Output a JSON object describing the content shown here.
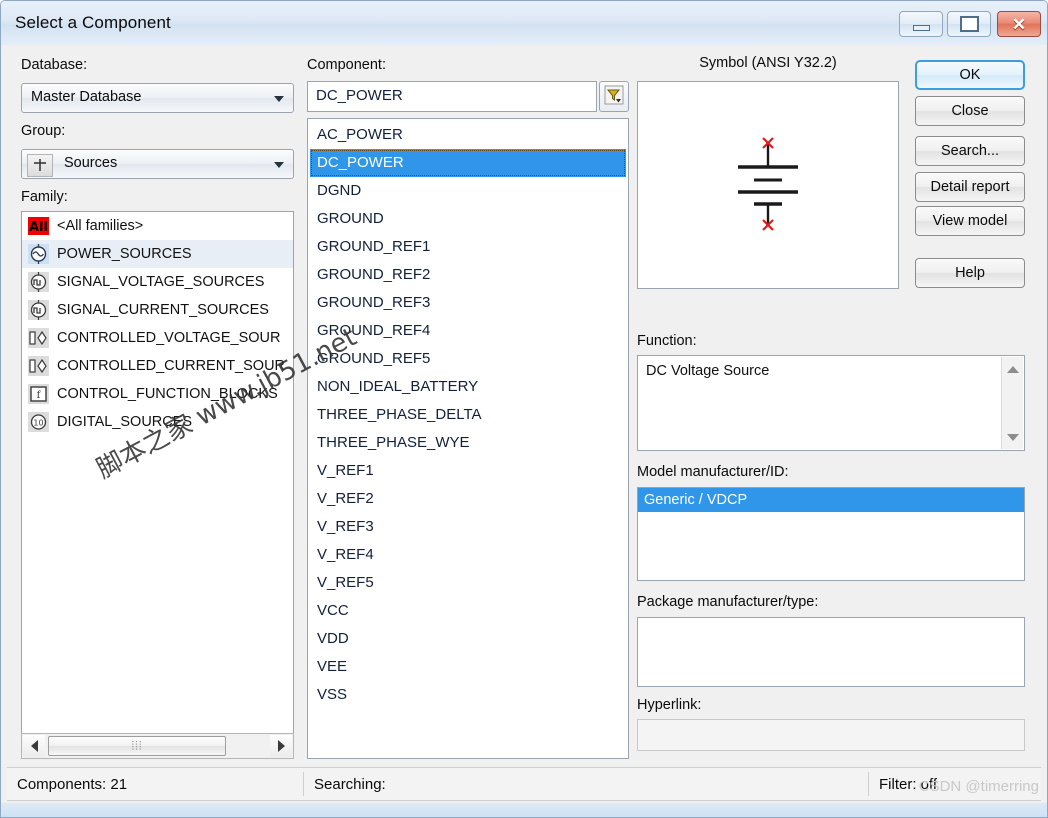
{
  "window": {
    "title": "Select a Component",
    "controls": {
      "minimize": "minimize-icon",
      "maximize": "maximize-icon",
      "close": "close-icon",
      "close_glyph": "✕"
    }
  },
  "left": {
    "database_label": "Database:",
    "database_value": "Master Database",
    "group_label": "Group:",
    "group_value": "Sources",
    "group_icon": "sources-icon",
    "family_label": "Family:",
    "families": [
      {
        "label": "<All families>",
        "icon": "all-families-icon",
        "selected": false
      },
      {
        "label": "POWER_SOURCES",
        "icon": "power-sources-icon",
        "selected": true
      },
      {
        "label": "SIGNAL_VOLTAGE_SOURCES",
        "icon": "signal-voltage-sources-icon",
        "selected": false
      },
      {
        "label": "SIGNAL_CURRENT_SOURCES",
        "icon": "signal-current-sources-icon",
        "selected": false
      },
      {
        "label": "CONTROLLED_VOLTAGE_SOUR",
        "icon": "controlled-voltage-sources-icon",
        "selected": false
      },
      {
        "label": "CONTROLLED_CURRENT_SOUR",
        "icon": "controlled-current-sources-icon",
        "selected": false
      },
      {
        "label": "CONTROL_FUNCTION_BLOCKS",
        "icon": "control-function-blocks-icon",
        "selected": false
      },
      {
        "label": "DIGITAL_SOURCES",
        "icon": "digital-sources-icon",
        "selected": false
      }
    ],
    "hscroll": {
      "left_arrow": "chevron-left-icon",
      "right_arrow": "chevron-right-icon",
      "grip": "⦙⦙⦙"
    }
  },
  "middle": {
    "component_label": "Component:",
    "component_value": "DC_POWER",
    "filter_button_icon": "filter-funnel-icon",
    "components": [
      {
        "label": "AC_POWER",
        "selected": false
      },
      {
        "label": "DC_POWER",
        "selected": true
      },
      {
        "label": "DGND",
        "selected": false
      },
      {
        "label": "GROUND",
        "selected": false
      },
      {
        "label": "GROUND_REF1",
        "selected": false
      },
      {
        "label": "GROUND_REF2",
        "selected": false
      },
      {
        "label": "GROUND_REF3",
        "selected": false
      },
      {
        "label": "GROUND_REF4",
        "selected": false
      },
      {
        "label": "GROUND_REF5",
        "selected": false
      },
      {
        "label": "NON_IDEAL_BATTERY",
        "selected": false
      },
      {
        "label": "THREE_PHASE_DELTA",
        "selected": false
      },
      {
        "label": "THREE_PHASE_WYE",
        "selected": false
      },
      {
        "label": "V_REF1",
        "selected": false
      },
      {
        "label": "V_REF2",
        "selected": false
      },
      {
        "label": "V_REF3",
        "selected": false
      },
      {
        "label": "V_REF4",
        "selected": false
      },
      {
        "label": "V_REF5",
        "selected": false
      },
      {
        "label": "VCC",
        "selected": false
      },
      {
        "label": "VDD",
        "selected": false
      },
      {
        "label": "VEE",
        "selected": false
      },
      {
        "label": "VSS",
        "selected": false
      }
    ]
  },
  "right": {
    "symbol_title": "Symbol (ANSI Y32.2)",
    "symbol_graphic": "dc-voltage-source-battery-symbol",
    "function_label": "Function:",
    "function_value": "DC Voltage Source",
    "model_label": "Model manufacturer/ID:",
    "models": [
      {
        "label": "Generic / VDCP",
        "selected": true
      }
    ],
    "package_label": "Package manufacturer/type:",
    "package_value": "",
    "hyperlink_label": "Hyperlink:",
    "hyperlink_value": ""
  },
  "buttons": {
    "ok": "OK",
    "close": "Close",
    "search": "Search...",
    "detail_report": "Detail report",
    "view_model": "View model",
    "help": "Help"
  },
  "statusbar": {
    "components": "Components: 21",
    "searching": "Searching:",
    "filter": "Filter: off"
  },
  "watermarks": {
    "main": "脚本之家 www.jb51.net",
    "csdn": "CSDN @timerring"
  },
  "colors": {
    "selection_blue": "#2f96ea",
    "titlebar_blue": "#d3e2f2",
    "close_red": "#e07458",
    "filter_gold": "#d8b21a",
    "symbol_pin_red": "#e01b1b"
  }
}
